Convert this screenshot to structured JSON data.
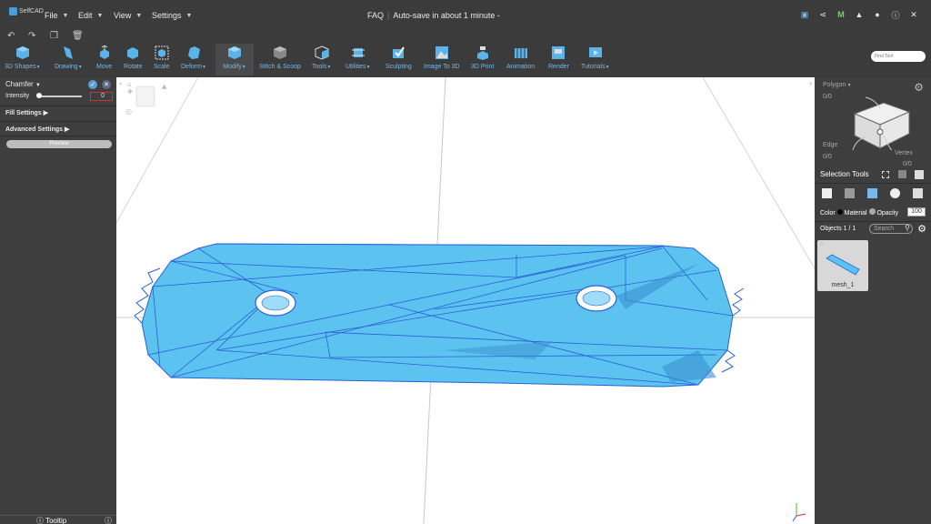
{
  "app": {
    "logo_text": "SelfCAD"
  },
  "menu": {
    "file": "File",
    "edit": "Edit",
    "view": "View",
    "settings": "Settings"
  },
  "title": {
    "faq": "FAQ",
    "autosave": "Auto-save in about 1 minute -"
  },
  "toolbar": {
    "items": [
      {
        "label": "3D Shapes"
      },
      {
        "label": "Drawing"
      },
      {
        "label": "Move"
      },
      {
        "label": "Rotate"
      },
      {
        "label": "Scale"
      },
      {
        "label": "Deform"
      },
      {
        "label": "Modify"
      },
      {
        "label": "Stitch & Scoop"
      },
      {
        "label": "Tools"
      },
      {
        "label": "Utilities"
      },
      {
        "label": "Sculpting"
      },
      {
        "label": "Image To 3D"
      },
      {
        "label": "3D Print"
      },
      {
        "label": "Animation"
      },
      {
        "label": "Render"
      },
      {
        "label": "Tutorials"
      }
    ],
    "find_placeholder": "Find Tool"
  },
  "left_panel": {
    "tool_title": "Chamfer",
    "intensity_label": "Intensity",
    "intensity_value": "0",
    "fill_settings": "Fill Settings",
    "advanced_settings": "Advanced Settings",
    "preview": "Preview",
    "tooltip": "Tooltip"
  },
  "right_panel": {
    "polygon_label": "Polygon",
    "polygon_count": "0/0",
    "edge_label": "Edge",
    "edge_count": "0/0",
    "vertex_label": "Vertex",
    "vertex_count": "0/0",
    "selection_tools": "Selection Tools",
    "color_label": "Color",
    "material_label": "Material",
    "opacity_label": "Opacity",
    "opacity_value": "100",
    "objects_label": "Objects 1 / 1",
    "search_placeholder": "Search",
    "mesh_name": "mesh_1"
  },
  "colors": {
    "accent": "#78b7e8",
    "mesh_fill": "#5cc3f0",
    "mesh_edge": "#2a5fd6",
    "panel": "#3e3e3e",
    "topbar": "#3b3b3b"
  }
}
